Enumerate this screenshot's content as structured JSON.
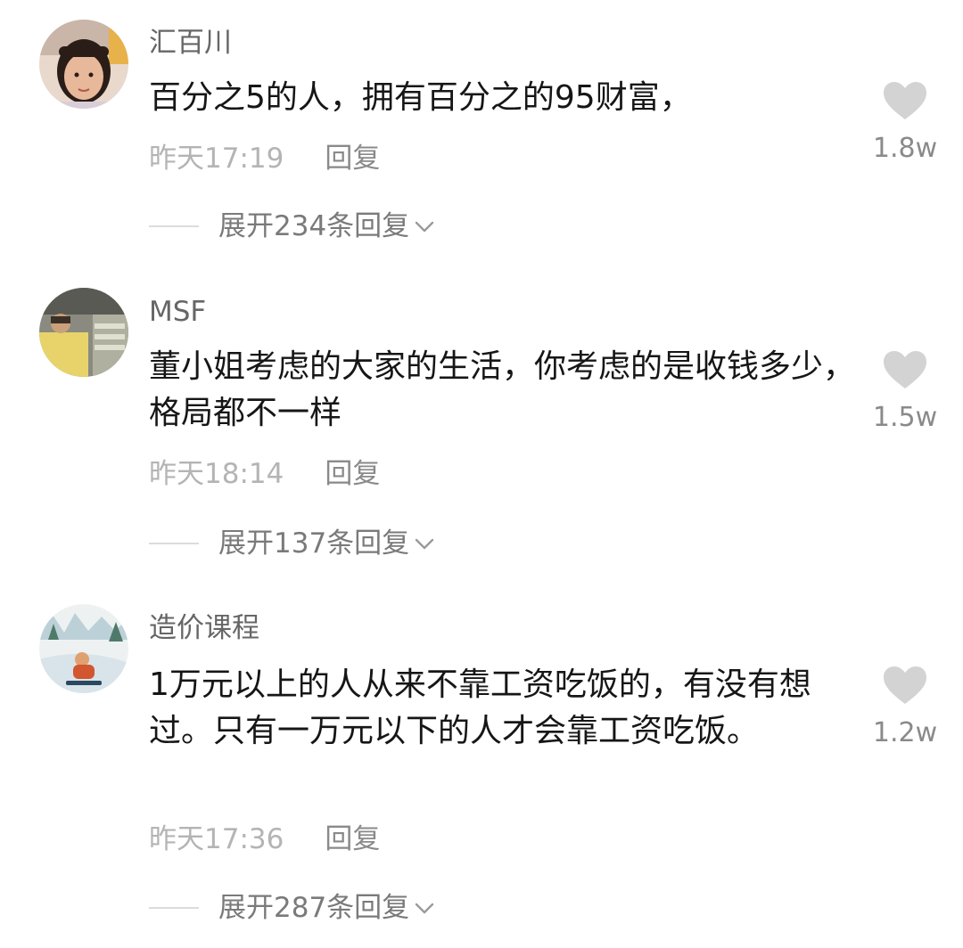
{
  "comments": [
    {
      "username": "汇百川",
      "text": "百分之5的人，拥有百分之的95财富，",
      "time": "昨天17:19",
      "reply_label": "回复",
      "expand_label": "展开234条回复",
      "likes": "1.8w"
    },
    {
      "username": "MSF",
      "text": "董小姐考虑的大家的生活，你考虑的是收钱多少，格局都不一样",
      "time": "昨天18:14",
      "reply_label": "回复",
      "expand_label": "展开137条回复",
      "likes": "1.5w"
    },
    {
      "username": "造价课程",
      "text": "1万元以上的人从来不靠工资吃饭的，有没有想过。只有一万元以下的人才会靠工资吃饭。",
      "time": "昨天17:36",
      "reply_label": "回复",
      "expand_label": "展开287条回复",
      "likes": "1.2w"
    }
  ],
  "icons": {
    "like": "heart-icon",
    "expand": "chevron-down-icon"
  },
  "colors": {
    "heart": "#d3d3d3",
    "time": "#b4b4b4",
    "secondary_text": "#8a8a8a"
  }
}
